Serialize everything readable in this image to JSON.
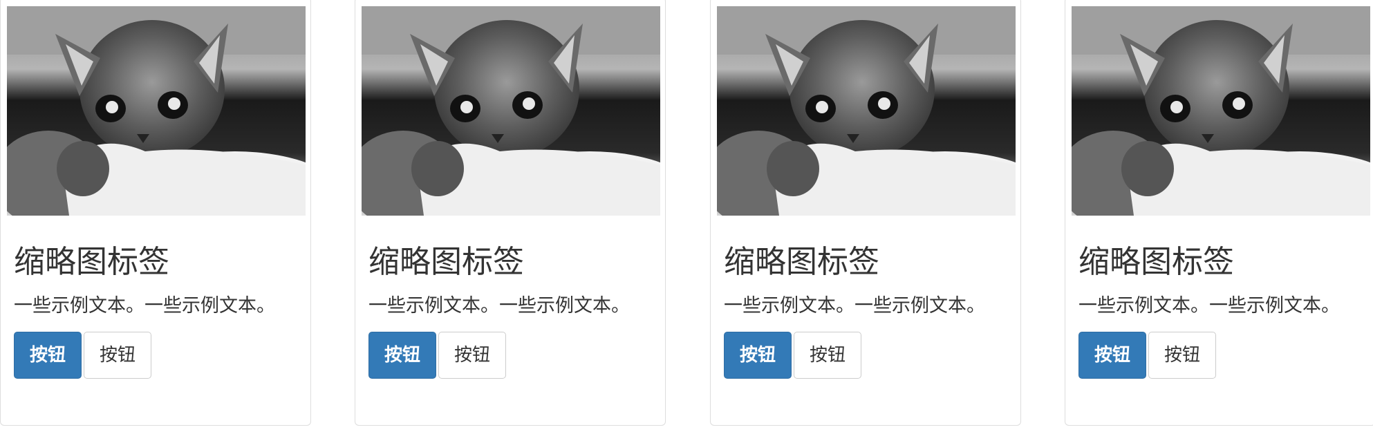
{
  "cards": [
    {
      "image_alt": "grayscale kitten photo",
      "title": "缩略图标签",
      "text": "一些示例文本。一些示例文本。",
      "primary_button": "按钮",
      "default_button": "按钮"
    },
    {
      "image_alt": "grayscale kitten photo",
      "title": "缩略图标签",
      "text": "一些示例文本。一些示例文本。",
      "primary_button": "按钮",
      "default_button": "按钮"
    },
    {
      "image_alt": "grayscale kitten photo",
      "title": "缩略图标签",
      "text": "一些示例文本。一些示例文本。",
      "primary_button": "按钮",
      "default_button": "按钮"
    },
    {
      "image_alt": "grayscale kitten photo",
      "title": "缩略图标签",
      "text": "一些示例文本。一些示例文本。",
      "primary_button": "按钮",
      "default_button": "按钮"
    }
  ],
  "colors": {
    "primary": "#337ab7",
    "primary_border": "#2e6da4",
    "card_border": "#dddddd",
    "text": "#333333"
  }
}
